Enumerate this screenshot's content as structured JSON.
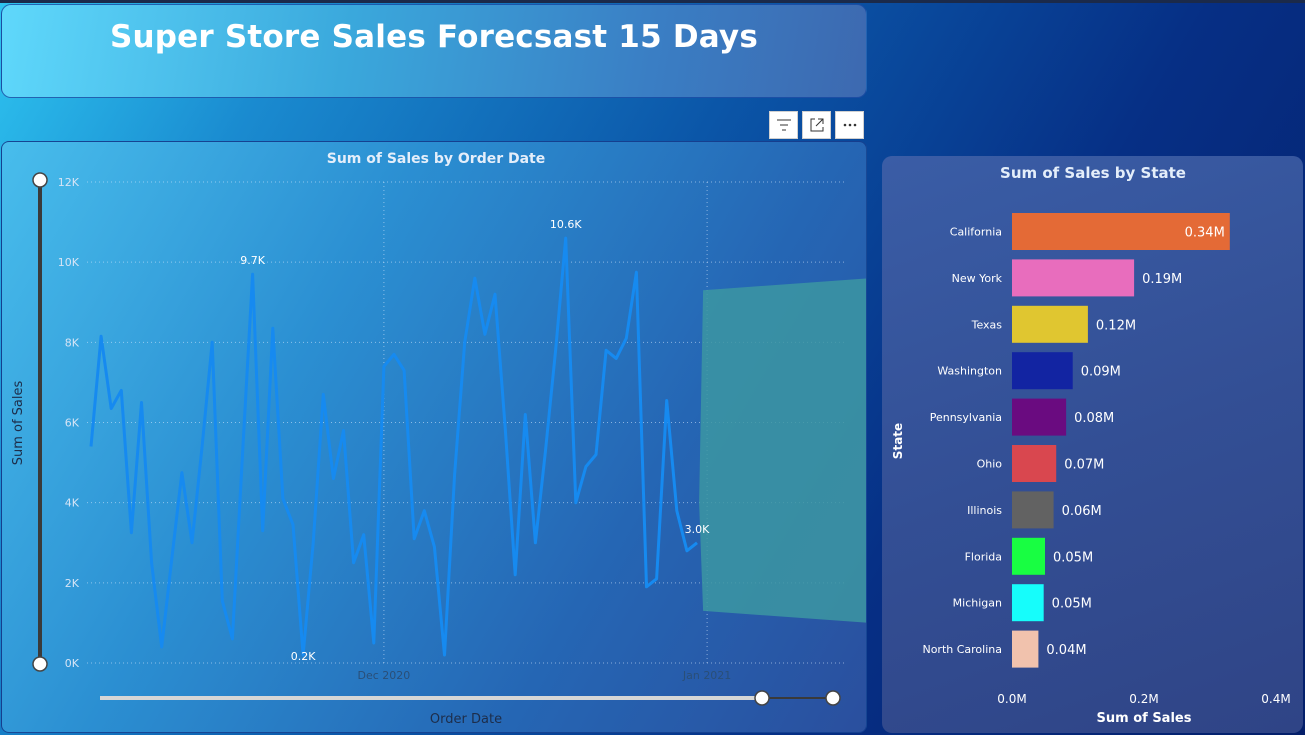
{
  "header": {
    "title": "Super Store Sales Forecsast 15 Days"
  },
  "toolbar": {
    "icons": [
      "filter-icon",
      "focus-mode-icon",
      "more-options-icon"
    ]
  },
  "colors": {
    "line": "#168af0",
    "forecast_band": "#3c97a2",
    "axis_text": "#d6e4f5"
  },
  "line_chart": {
    "chart_data": {
      "type": "line",
      "title": "Sum of Sales by Order Date",
      "xlabel": "Order Date",
      "ylabel": "Sum of Sales",
      "ylim": [
        0,
        12000
      ],
      "y_ticks": [
        "0K",
        "2K",
        "4K",
        "6K",
        "8K",
        "10K",
        "12K"
      ],
      "x_ticks": [
        {
          "label": "Dec 2020",
          "index": 29
        },
        {
          "label": "Jan 2021",
          "index": 61
        }
      ],
      "grid": true,
      "series": [
        {
          "values": [
            5400,
            8150,
            6350,
            6800,
            3250,
            6500,
            2500,
            400,
            2600,
            4750,
            3000,
            5400,
            8000,
            1550,
            600,
            5200,
            9700,
            3300,
            8350,
            4100,
            3450,
            200,
            3000,
            6700,
            4600,
            5800,
            2500,
            3200,
            500,
            7400,
            7700,
            7300,
            3100,
            3800,
            2900,
            200,
            4700,
            8000,
            9600,
            8200,
            9200,
            5900,
            2200,
            6200,
            3000,
            5300,
            7800,
            10600,
            4000,
            4900,
            5200,
            7800,
            7600,
            8100,
            9750,
            1900,
            2100,
            6550,
            3800,
            2800,
            3000
          ],
          "point_labels": [
            {
              "index": 16,
              "text": "9.7K"
            },
            {
              "index": 21,
              "text": "0.2K"
            },
            {
              "index": 47,
              "text": "10.6K"
            },
            {
              "index": 60,
              "text": "3.0K"
            }
          ]
        }
      ],
      "forecast_band": {
        "start_index": 61,
        "end_index": 76,
        "upper_start": 9300,
        "upper_end": 9600,
        "lower_start": 1300,
        "lower_end": 1000
      }
    }
  },
  "bar_chart": {
    "chart_data": {
      "type": "bar",
      "orientation": "horizontal",
      "title": "Sum of Sales by State",
      "xlabel": "Sum of Sales",
      "ylabel": "State",
      "xlim": [
        0,
        400000
      ],
      "x_ticks": [
        "0.0M",
        "0.2M",
        "0.4M"
      ],
      "categories": [
        "California",
        "New York",
        "Texas",
        "Washington",
        "Pennsylvania",
        "Ohio",
        "Illinois",
        "Florida",
        "Michigan",
        "North Carolina"
      ],
      "values": [
        330000,
        185000,
        115000,
        92000,
        82000,
        67000,
        63000,
        50000,
        48000,
        40000
      ],
      "labels": [
        "0.34M",
        "0.19M",
        "0.12M",
        "0.09M",
        "0.08M",
        "0.07M",
        "0.06M",
        "0.05M",
        "0.05M",
        "0.04M"
      ],
      "colors": [
        "#e46a36",
        "#e86dbd",
        "#e0c630",
        "#1224a2",
        "#6a0b80",
        "#d9474f",
        "#626262",
        "#18fe42",
        "#16fdfb",
        "#f1c2ad"
      ]
    }
  }
}
